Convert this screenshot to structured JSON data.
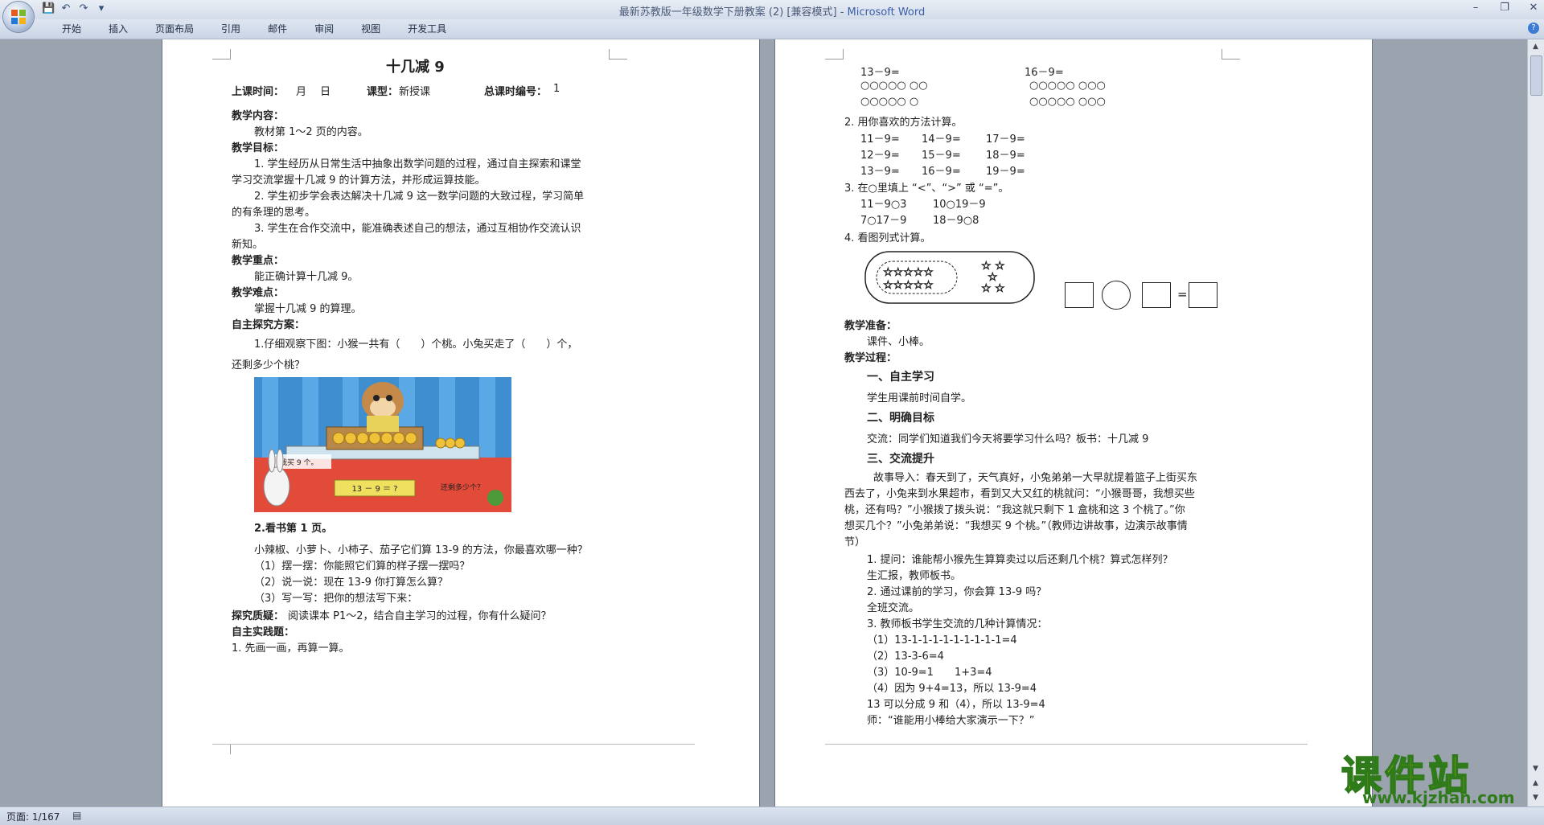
{
  "window": {
    "title": "最新苏教版一年级数学下册教案 (2) [兼容模式]",
    "app": "Microsoft Word"
  },
  "ribbon": {
    "tabs": [
      "开始",
      "插入",
      "页面布局",
      "引用",
      "邮件",
      "审阅",
      "视图",
      "开发工具"
    ]
  },
  "status": {
    "page": "页面: 1/167"
  },
  "watermark": {
    "big": "课件站",
    "small": "www.kjzhan.com"
  },
  "page1": {
    "title": "十几减 9",
    "info_time": "上课时间：",
    "info_month": "月",
    "info_day": "日",
    "info_type_label": "课型：",
    "info_type": "新授课",
    "info_num_label": "总课时编号：",
    "info_num": "1",
    "h_content": "教学内容：",
    "content": "教材第 1～2 页的内容。",
    "h_goal": "教学目标：",
    "goal1a": "1. 学生经历从日常生活中抽象出数学问题的过程，通过自主探索和课堂",
    "goal1b": "学习交流掌握十几减 9 的计算方法，并形成运算技能。",
    "goal2a": "2. 学生初步学会表达解决十几减 9 这一数学问题的大致过程，学习简单",
    "goal2b": "的有条理的思考。",
    "goal3a": "3. 学生在合作交流中，能准确表述自己的想法，通过互相协作交流认识",
    "goal3b": "新知。",
    "h_key": "教学重点：",
    "key": "能正确计算十几减 9。",
    "h_diff": "教学难点：",
    "diff": "掌握十几减 9 的算理。",
    "h_plan": "自主探究方案：",
    "plan1a": "1.仔细观察下图：小猴一共有（　　）个桃。小兔买走了（　　）个，",
    "plan1b": "还剩多少个桃？",
    "pic_label_buy": "我买 9 个。",
    "pic_label_eq": "13 － 9 ＝ ?",
    "pic_label_left": "还剩多少个？",
    "plan2": "2.看书第 1 页。",
    "plan2_q": "小辣椒、小萝卜、小柿子、茄子它们算 13-9 的方法，你最喜欢哪一种？",
    "plan2_1": "（1）摆一摆：你能照它们算的样子摆一摆吗？",
    "plan2_2": "（2）说一说：现在 13-9 你打算怎么算？",
    "plan2_3": "（3）写一写：把你的想法写下来：",
    "h_doubt": "探究质疑：",
    "doubt": "阅读课本 P1～2，结合自主学习的过程，你有什么疑问？",
    "h_practice": "自主实践题：",
    "practice1": "1. 先画一画，再算一算。"
  },
  "page2": {
    "eq_a": "13－9=",
    "eq_b": "16－9=",
    "circles_a1": "○○○○○ ○○",
    "circles_a2": "○○○○○ ○",
    "circles_b1": "○○○○○ ○○○",
    "circles_b2": "○○○○○ ○○○",
    "q2": "2. 用你喜欢的方法计算。",
    "r1": [
      "11－9=",
      "14－9=",
      "17－9="
    ],
    "r2": [
      "12－9=",
      "15－9=",
      "18－9="
    ],
    "r3": [
      "13－9=",
      "16－9=",
      "19－9="
    ],
    "q3": "3. 在○里填上 “<”、“>” 或 “=”。",
    "cmp1a": "11－9○3",
    "cmp1b": "10○19－9",
    "cmp2a": "7○17－9",
    "cmp2b": "18－9○8",
    "q4": "4. 看图列式计算。",
    "eq_sign": "=",
    "h_prep": "教学准备：",
    "prep": "课件、小棒。",
    "h_process": "教学过程：",
    "s1": "一、自主学习",
    "s1_text": "学生用课前时间自学。",
    "s2": "二、明确目标",
    "s2_text": "交流：同学们知道我们今天将要学习什么吗？板书：十几减 9",
    "s3": "三、交流提升",
    "story1": "故事导入：春天到了，天气真好，小兔弟弟一大早就提着篮子上街买东",
    "story2": "西去了，小兔来到水果超市，看到又大又红的桃就问：“小猴哥哥，我想买些",
    "story3": "桃，还有吗？”小猴拨了拨头说：“我这就只剩下 1 盒桃和这 3 个桃了。”你",
    "story4": "想买几个？”小兔弟弟说：“我想买 9 个桃。”（教师边讲故事，边演示故事情",
    "story5": "节）",
    "ask1": "1. 提问：谁能帮小猴先生算算卖过以后还剩几个桃？算式怎样列？",
    "ask1b": "生汇报，教师板书。",
    "ask2": "2. 通过课前的学习，你会算 13-9 吗？",
    "ask2b": "全班交流。",
    "ask3": "3. 教师板书学生交流的几种计算情况：",
    "m1": "（1）13-1-1-1-1-1-1-1-1-1=4",
    "m2": "（2）13-3-6=4",
    "m3": "（3）10-9=1　　1+3=4",
    "m4": "（4）因为 9+4=13，所以 13-9=4",
    "m5": "13 可以分成 9 和（4），所以 13-9=4",
    "m6": "师：“谁能用小棒给大家演示一下？”"
  }
}
